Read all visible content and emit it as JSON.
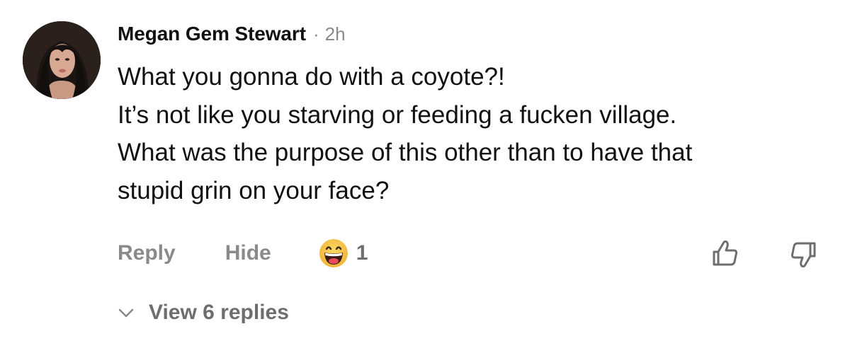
{
  "comment": {
    "author": "Megan Gem Stewart",
    "separator": "·",
    "time": "2h",
    "lines": [
      "What you gonna do with a coyote?!",
      "It’s not like you starving or feeding a fucken village.",
      "What was the purpose of this other than to have that",
      "stupid grin on your face?"
    ]
  },
  "actions": {
    "reply_label": "Reply",
    "hide_label": "Hide",
    "reaction_icon": "grinning-face-emoji",
    "reaction_count": "1",
    "upvote_icon": "thumbs-up-icon",
    "downvote_icon": "thumbs-down-icon"
  },
  "replies": {
    "toggle_icon": "chevron-down-icon",
    "label": "View 6 replies"
  },
  "colors": {
    "text": "#111111",
    "muted": "#8a8a8a",
    "emoji_yellow": "#f7c84a"
  }
}
